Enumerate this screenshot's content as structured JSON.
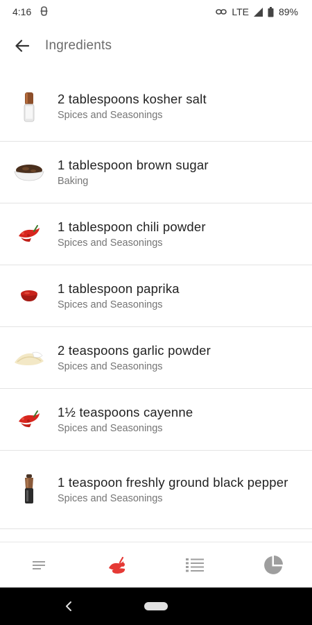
{
  "status_bar": {
    "time": "4:16",
    "network": "LTE",
    "battery": "89%"
  },
  "app_bar": {
    "title": "Ingredients",
    "back_icon": "arrow-back-icon"
  },
  "ingredients": [
    {
      "name": "2 tablespoons kosher salt",
      "category": "Spices and Seasonings",
      "icon": "salt-grinder-icon"
    },
    {
      "name": "1 tablespoon brown sugar",
      "category": "Baking",
      "icon": "brown-sugar-bowl-icon"
    },
    {
      "name": "1 tablespoon chili powder",
      "category": "Spices and Seasonings",
      "icon": "chili-pepper-icon"
    },
    {
      "name": "1 tablespoon paprika",
      "category": "Spices and Seasonings",
      "icon": "paprika-bowl-icon"
    },
    {
      "name": "2 teaspoons garlic powder",
      "category": "Spices and Seasonings",
      "icon": "garlic-powder-icon"
    },
    {
      "name": "1½ teaspoons cayenne",
      "category": "Spices and Seasonings",
      "icon": "chili-pepper-icon"
    },
    {
      "name": "1 teaspoon freshly ground black pepper",
      "category": "Spices and Seasonings",
      "icon": "pepper-grinder-icon"
    }
  ],
  "bottom_nav": {
    "items": [
      "description-icon",
      "ingredients-icon",
      "steps-icon",
      "nutrition-icon"
    ],
    "active": "ingredients-icon"
  },
  "colors": {
    "accent": "#e53935",
    "nav_inactive": "#9e9e9e",
    "divider": "#e3e3e3"
  }
}
